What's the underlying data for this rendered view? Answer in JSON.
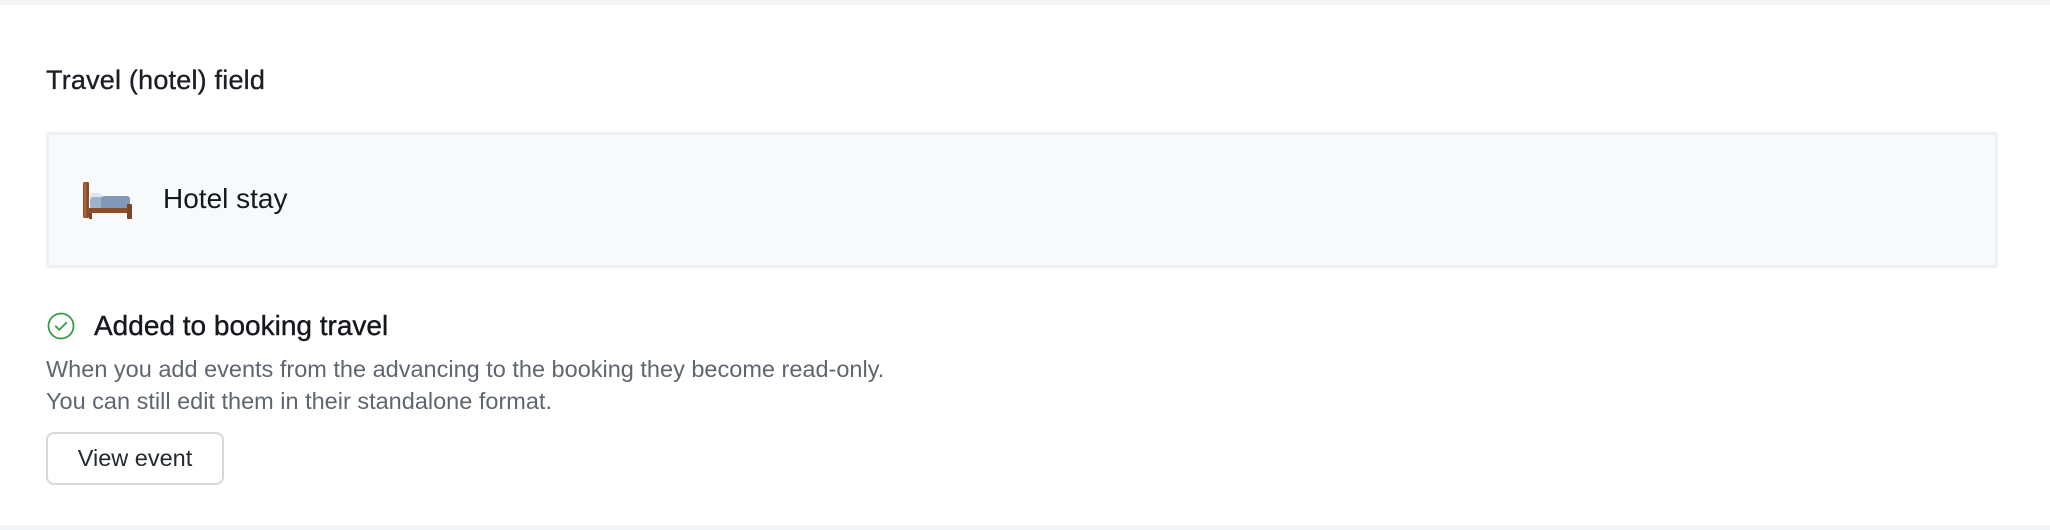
{
  "section": {
    "title": "Travel (hotel) field"
  },
  "field": {
    "icon": "bed-icon",
    "label": "Hotel stay"
  },
  "status": {
    "icon": "check-circle-icon",
    "icon_color": "#3c9a4e",
    "title": "Added to booking travel",
    "description_lines": [
      "When you add events from the advancing to the booking they become read-only.",
      "You can still edit them in their standalone format."
    ]
  },
  "actions": {
    "view_event_label": "View event"
  }
}
